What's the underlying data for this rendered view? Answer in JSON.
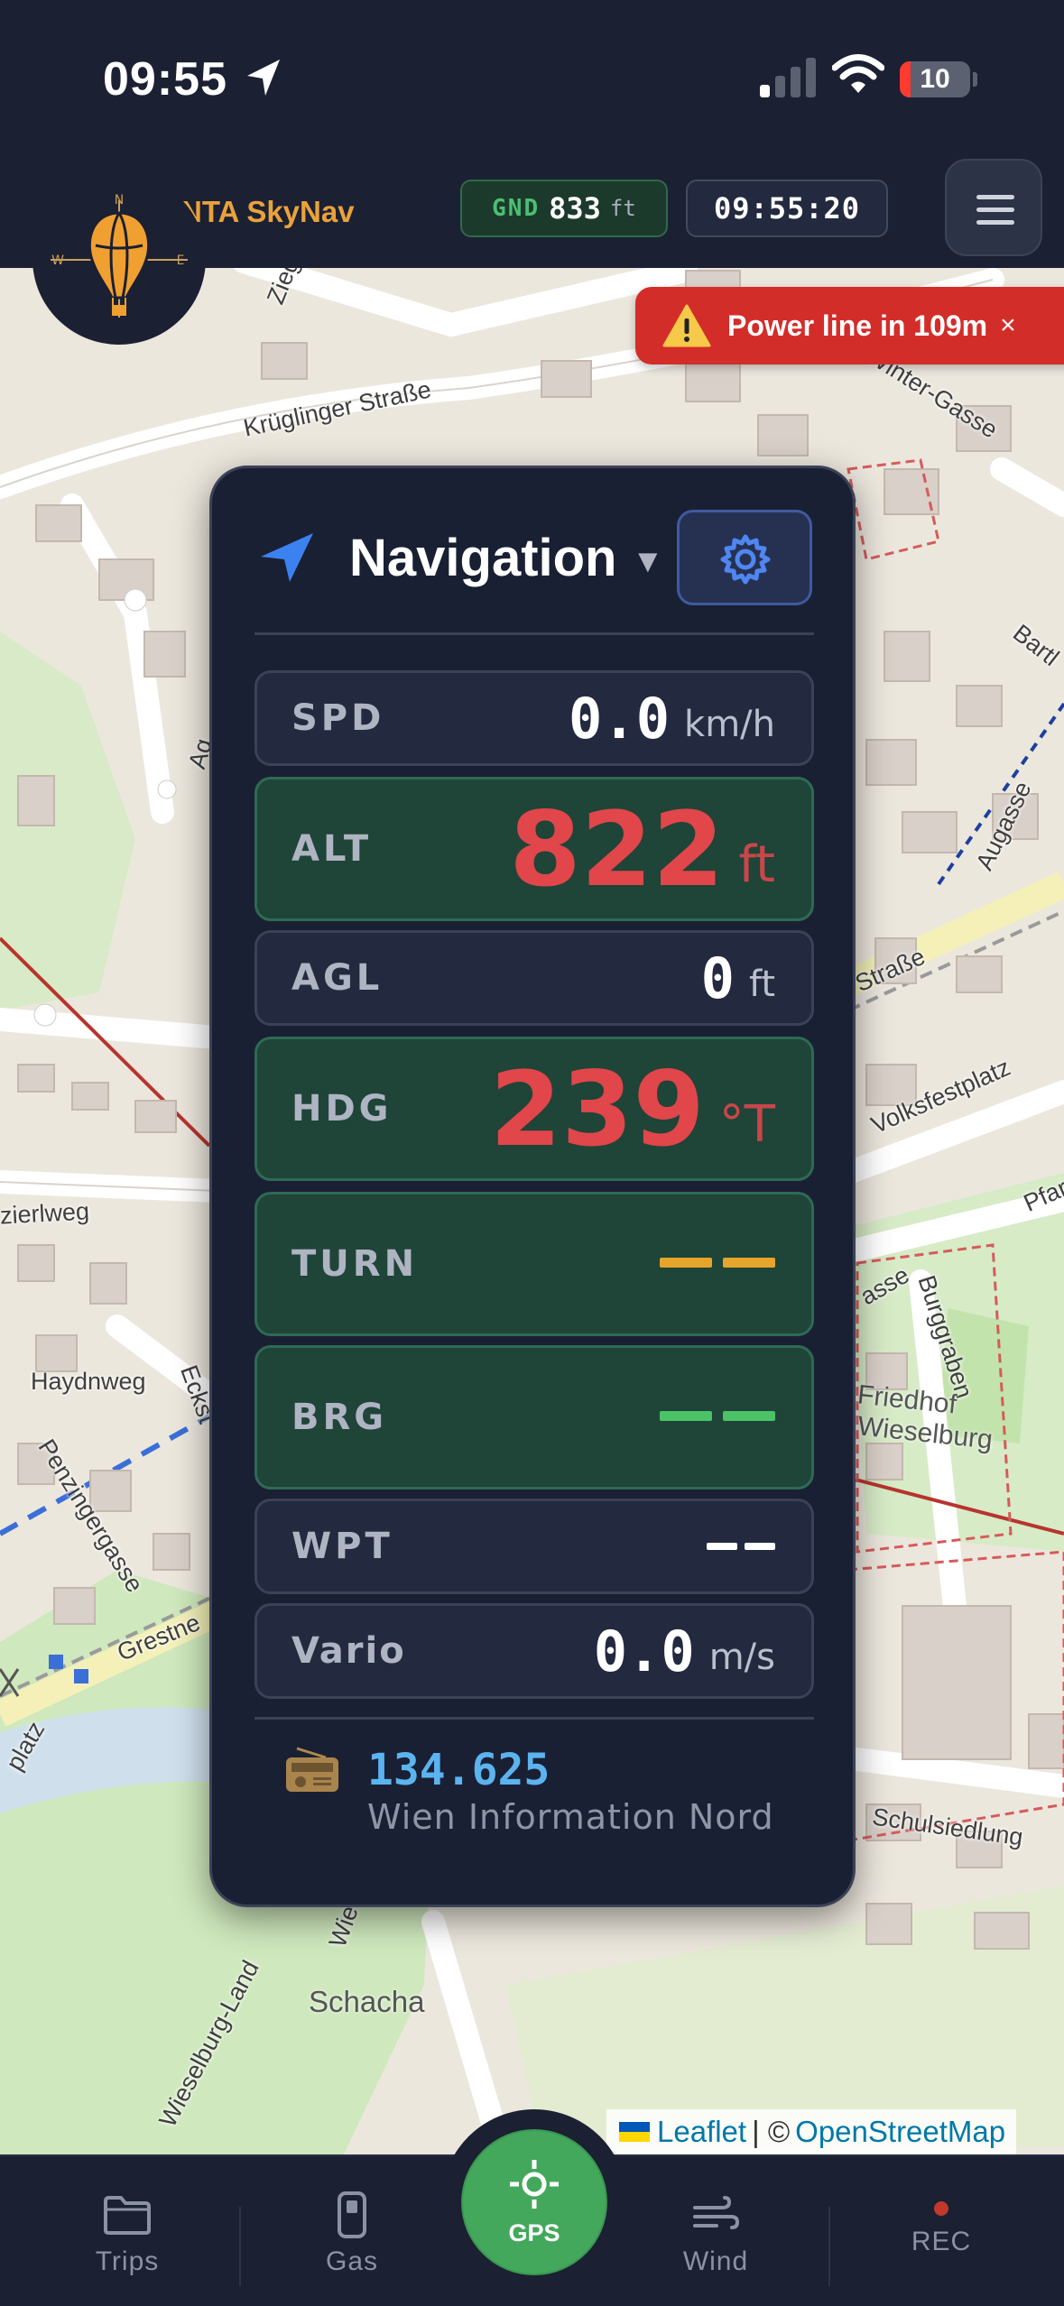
{
  "status_bar": {
    "time": "09:55",
    "battery": "10"
  },
  "header": {
    "app_title": "NTA SkyNav",
    "compass_letters": {
      "n": "N",
      "w": "W",
      "e": "E"
    },
    "gnd": {
      "label": "GND",
      "value": "833",
      "unit": "ft"
    },
    "clock": "09:55:20"
  },
  "alert": {
    "text": "Power line in 109m",
    "close": "×"
  },
  "map": {
    "streets": [
      "Ziegelofenweg",
      "Krüglinger Straße",
      "Winter-Gasse",
      "Bartl",
      "Augasse",
      "Straße",
      "Volksfestplatz",
      "Pfar",
      "zierlweg",
      "Haydnweg",
      "Eckst",
      "Penzingergasse",
      "Grestne",
      "platz",
      "Burggraben",
      "Schulsiedlung",
      "Wieselburg-Land",
      "Wie",
      "Ag",
      "asse"
    ],
    "places": [
      "Friedhof",
      "Wieselburg",
      "Schacha"
    ]
  },
  "panel": {
    "title": "Navigation",
    "caret": "▼",
    "rows": {
      "spd": {
        "label": "SPD",
        "value": "0.0",
        "unit": "km/h"
      },
      "alt": {
        "label": "ALT",
        "value": "822",
        "unit": "ft"
      },
      "agl": {
        "label": "AGL",
        "value": "0",
        "unit": "ft"
      },
      "hdg": {
        "label": "HDG",
        "value": "239",
        "unit": "°T"
      },
      "turn": {
        "label": "TURN"
      },
      "brg": {
        "label": "BRG"
      },
      "wpt": {
        "label": "WPT"
      },
      "vario": {
        "label": "Vario",
        "value": "0.0",
        "unit": "m/s"
      }
    },
    "radio": {
      "frequency": "134.625",
      "name": "Wien Information Nord"
    }
  },
  "attribution": {
    "leaflet": "Leaflet",
    "separator": "| ©",
    "osm": "OpenStreetMap"
  },
  "bottom_nav": {
    "trips": "Trips",
    "gas": "Gas",
    "gps": "GPS",
    "wind": "Wind",
    "rec": "REC"
  },
  "colors": {
    "bar_bg": "#1b2033",
    "panel_bg": "#1a2033",
    "green_row": "#1f4438",
    "alert_red": "#d32d2a",
    "value_red": "#e0464a",
    "turn_dash": "#e5a52b",
    "brg_dash": "#4cc266",
    "freq_blue": "#5bb3ef",
    "gps_green": "#43a85b",
    "brand_orange": "#e9a23b"
  },
  "icons": [
    "location-arrow-icon",
    "signal-icon",
    "wifi-icon",
    "battery-icon",
    "balloon-logo-icon",
    "menu-icon",
    "warning-icon",
    "navigation-arrow-icon",
    "gear-icon",
    "radio-icon",
    "folder-icon",
    "fuel-icon",
    "crosshair-icon",
    "wind-icon"
  ]
}
